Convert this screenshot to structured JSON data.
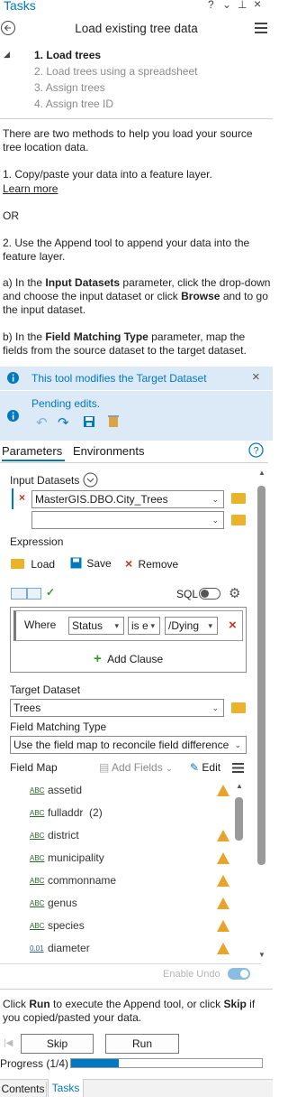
{
  "window": {
    "title": "Tasks",
    "controls": [
      "?",
      "⌄",
      "⊥",
      "×"
    ]
  },
  "task": {
    "title": "Load existing tree data"
  },
  "steps": [
    {
      "num": "1.",
      "label": "Load trees",
      "active": true
    },
    {
      "num": "2.",
      "label": "Load trees using a spreadsheet",
      "active": false
    },
    {
      "num": "3.",
      "label": "Assign trees",
      "active": false
    },
    {
      "num": "4.",
      "label": "Assign tree ID",
      "active": false
    }
  ],
  "instructions": {
    "p1": "There are two methods to help you load your source tree location data.",
    "p2": "1. Copy/paste your data into a feature layer.",
    "learn_more": "Learn more",
    "or": "OR",
    "p3": "2. Use the Append tool to append your data into the feature layer.",
    "p4a_prefix": "a) In the ",
    "p4a_bold": "Input Datasets",
    "p4a_mid": " parameter, click the drop-down and choose the input dataset or click ",
    "p4a_bold2": "Browse",
    "p4a_suffix": " and to go the input dataset.",
    "p4b_prefix": "b) In the ",
    "p4b_bold": "Field Matching Type",
    "p4b_suffix": " parameter, map the fields from the source dataset to the target dataset."
  },
  "banner_modifies": "This tool modifies the Target Dataset",
  "banner_pending": "Pending edits.",
  "tool_tabs": {
    "parameters": "Parameters",
    "environments": "Environments"
  },
  "input_datasets": {
    "label": "Input Datasets",
    "value1": "MasterGIS.DBO.City_Trees",
    "value2": ""
  },
  "expression": {
    "label": "Expression",
    "load": "Load",
    "save": "Save",
    "remove": "Remove",
    "sql": "SQL",
    "where": "Where",
    "field": "Status",
    "operator": "is e",
    "value": "/Dying",
    "add_clause": "Add Clause"
  },
  "target_dataset": {
    "label": "Target Dataset",
    "value": "Trees"
  },
  "field_matching": {
    "label": "Field Matching Type",
    "value": "Use the field map to reconcile field difference"
  },
  "field_map": {
    "label": "Field Map",
    "add_fields": "Add Fields",
    "edit": "Edit",
    "fields": [
      {
        "type": "ABC",
        "name": "assetid",
        "warn": true
      },
      {
        "type": "ABC",
        "name": "fulladdr  (2)",
        "warn": false
      },
      {
        "type": "ABC",
        "name": "district",
        "warn": true
      },
      {
        "type": "ABC",
        "name": "municipality",
        "warn": true
      },
      {
        "type": "ABC",
        "name": "commonname",
        "warn": true
      },
      {
        "type": "ABC",
        "name": "genus",
        "warn": true
      },
      {
        "type": "ABC",
        "name": "species",
        "warn": true
      },
      {
        "type": "0.01",
        "name": "diameter",
        "warn": true
      }
    ]
  },
  "enable_undo": "Enable Undo",
  "footer": {
    "prefix": "Click ",
    "run_bold": "Run",
    "mid": " to execute the Append tool, or click ",
    "skip_bold": "Skip",
    "suffix": " if you copied/pasted your data.",
    "skip": "Skip",
    "run": "Run",
    "progress_label": "Progress (1/4)",
    "progress_fraction": 0.25
  },
  "bottom_tabs": {
    "contents": "Contents",
    "tasks": "Tasks"
  },
  "colors": {
    "accent": "#0079c1",
    "banner": "#dbeaf6",
    "warning": "#e8a32a",
    "remove": "#c8351e"
  }
}
